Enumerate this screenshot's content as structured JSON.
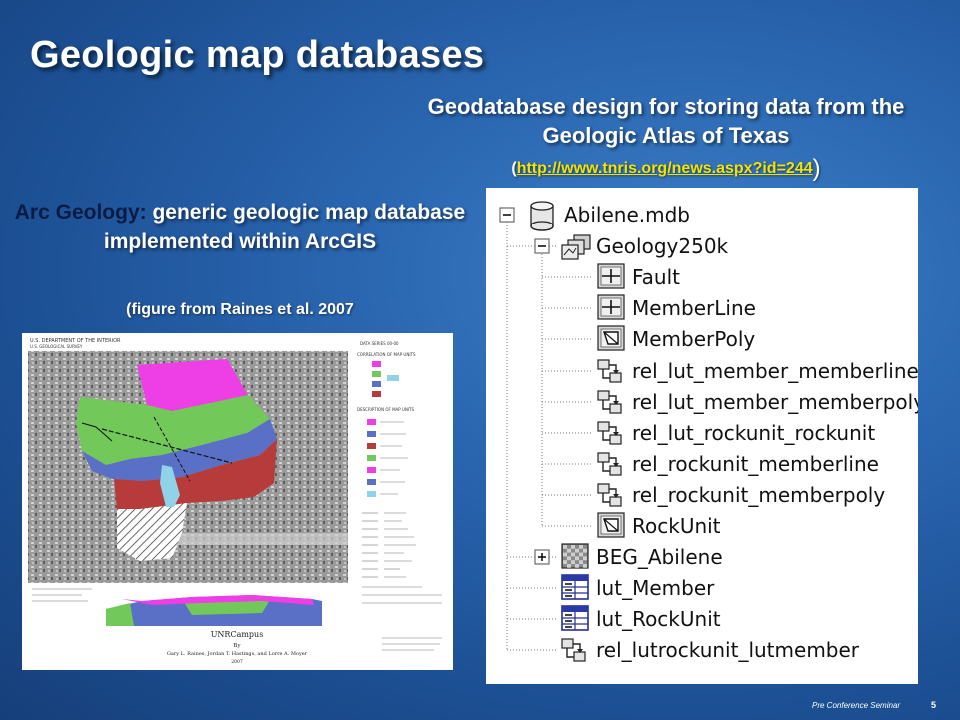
{
  "slide": {
    "title": "Geologic map databases",
    "geodatabase": {
      "title": "Geodatabase design for storing data from the Geologic Atlas of Texas",
      "paren_open": "(",
      "link": "http://www.tnris.org/news.aspx?id=244",
      "paren_close": ")"
    },
    "arc": {
      "lead": "Arc Geology:",
      "rest": " generic geologic map database implemented within ArcGIS",
      "caption": "(figure from Raines et al. 2007"
    },
    "map_figure": {
      "campus_title": "UNRCampus",
      "by": "By",
      "authors": "Gary L. Raines, Jordan T. Hastings, and Lorre A. Moyer",
      "year": "2007"
    },
    "tree": {
      "items": [
        {
          "label": "Abilene.mdb",
          "icon": "database-icon",
          "expander": "minus"
        },
        {
          "label": "Geology250k",
          "icon": "feature-dataset-icon",
          "expander": "minus"
        },
        {
          "label": "Fault",
          "icon": "line-feature-class-icon",
          "expander": ""
        },
        {
          "label": "MemberLine",
          "icon": "line-feature-class-icon",
          "expander": ""
        },
        {
          "label": "MemberPoly",
          "icon": "polygon-feature-class-icon",
          "expander": ""
        },
        {
          "label": "rel_lut_member_memberline",
          "icon": "relationship-class-icon",
          "expander": ""
        },
        {
          "label": "rel_lut_member_memberpoly",
          "icon": "relationship-class-icon",
          "expander": ""
        },
        {
          "label": "rel_lut_rockunit_rockunit",
          "icon": "relationship-class-icon",
          "expander": ""
        },
        {
          "label": "rel_rockunit_memberline",
          "icon": "relationship-class-icon",
          "expander": ""
        },
        {
          "label": "rel_rockunit_memberpoly",
          "icon": "relationship-class-icon",
          "expander": ""
        },
        {
          "label": "RockUnit",
          "icon": "polygon-feature-class-icon",
          "expander": ""
        },
        {
          "label": "BEG_Abilene",
          "icon": "raster-icon",
          "expander": "plus"
        },
        {
          "label": "lut_Member",
          "icon": "table-icon",
          "expander": ""
        },
        {
          "label": "lut_RockUnit",
          "icon": "table-icon",
          "expander": ""
        },
        {
          "label": "rel_lutrockunit_lutmember",
          "icon": "relationship-class-icon",
          "expander": ""
        }
      ]
    },
    "footer": "Pre Conference Seminar",
    "page_number": "5"
  }
}
